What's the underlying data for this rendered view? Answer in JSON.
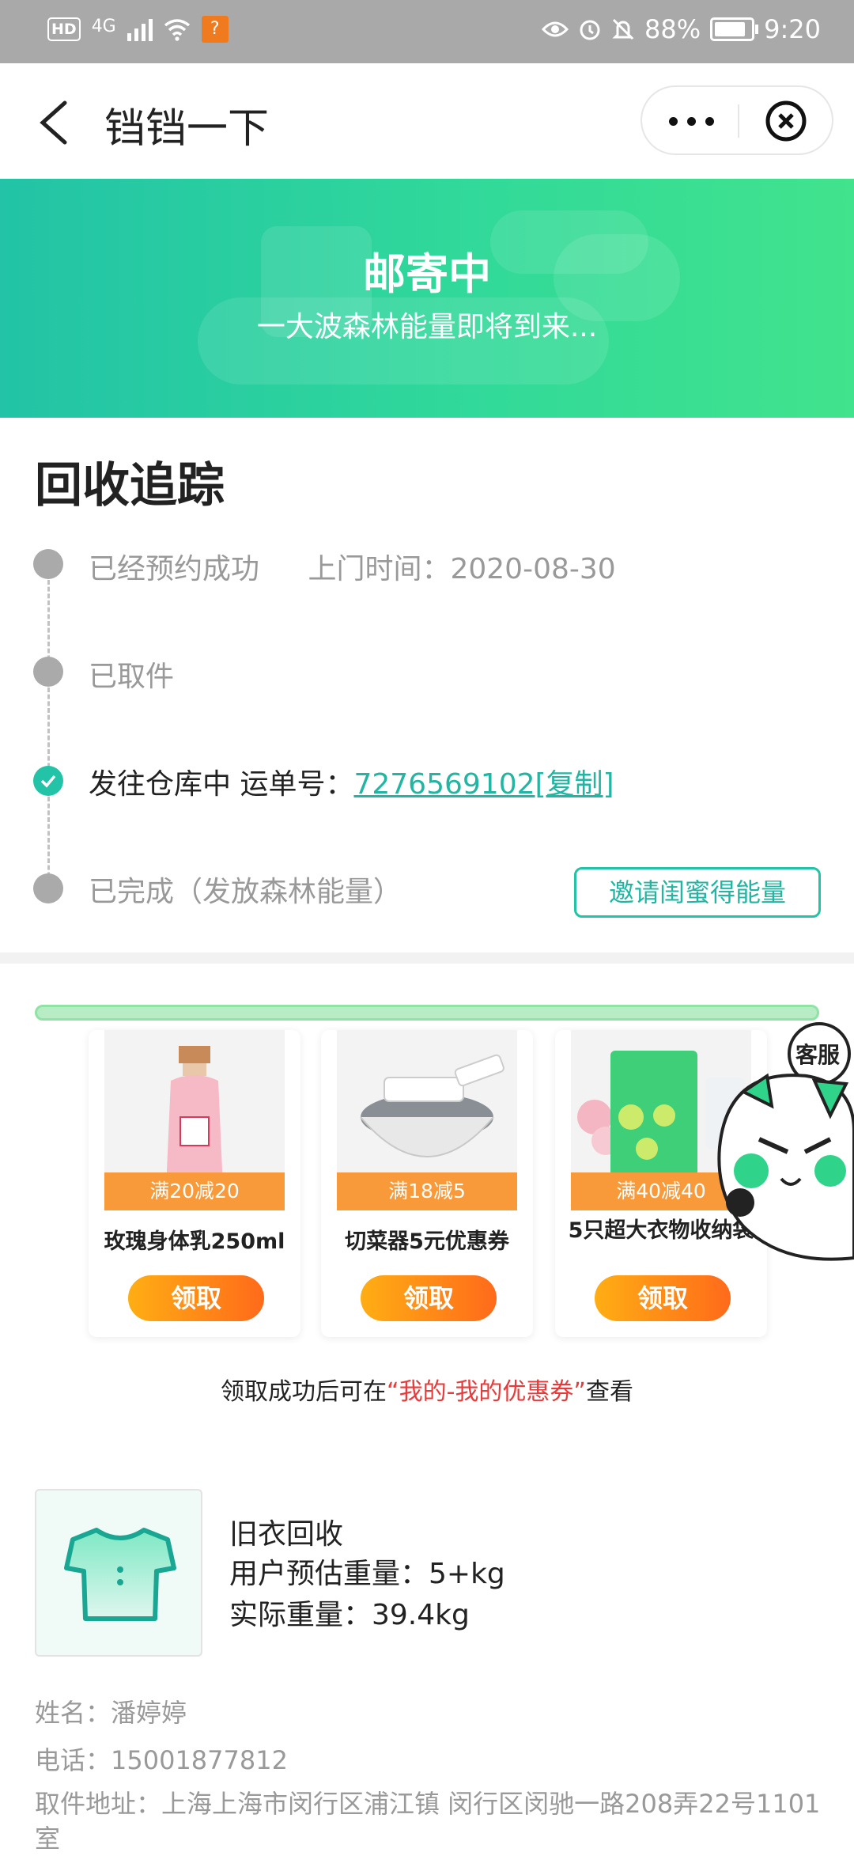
{
  "status_bar": {
    "hd": "HD",
    "network": "4G",
    "battery_percent": "88%",
    "time": "9:20"
  },
  "title_bar": {
    "title": "铛铛一下"
  },
  "banner": {
    "title": "邮寄中",
    "subtitle": "一大波森林能量即将到来...",
    "gradient_start": "#22c3a6",
    "gradient_end": "#41e38c"
  },
  "tracking": {
    "heading": "回收追踪",
    "steps": [
      {
        "label": "已经预约成功",
        "extra": "上门时间：2020-08-30",
        "state": "done"
      },
      {
        "label": "已取件",
        "state": "done"
      },
      {
        "label": "发往仓库中 运单号：",
        "waybill": "7276569102",
        "copy": "[复制]",
        "state": "current"
      },
      {
        "label": "已完成（发放森林能量）",
        "state": "pending"
      }
    ],
    "invite_button": "邀请闺蜜得能量"
  },
  "coupons": {
    "items": [
      {
        "tag": "满20减20",
        "name": "玫瑰身体乳250ml",
        "button": "领取"
      },
      {
        "tag": "满18减5",
        "name": "切菜器5元优惠券",
        "button": "领取"
      },
      {
        "tag": "满40减40",
        "name": "5只超大衣物收纳袋",
        "button": "领取"
      }
    ],
    "note_prefix": "领取成功后可在",
    "note_highlight": "“我的-我的优惠券”",
    "note_suffix": "查看",
    "customer_service": "客服"
  },
  "order": {
    "category": "旧衣回收",
    "estimated_weight": "用户预估重量：5+kg",
    "actual_weight": "实际重量：39.4kg",
    "name": "姓名：潘婷婷",
    "phone": "电话：15001877812",
    "address": "取件地址：上海上海市闵行区浦江镇 闵行区闵驰一路208弄22号1101室"
  },
  "colors": {
    "accent": "#22c3a6",
    "link": "#22b5a2",
    "coupon_tag": "#f89a3a",
    "button_start": "#ffae14",
    "button_end": "#ff6a1a",
    "highlight": "#e83a3a"
  }
}
